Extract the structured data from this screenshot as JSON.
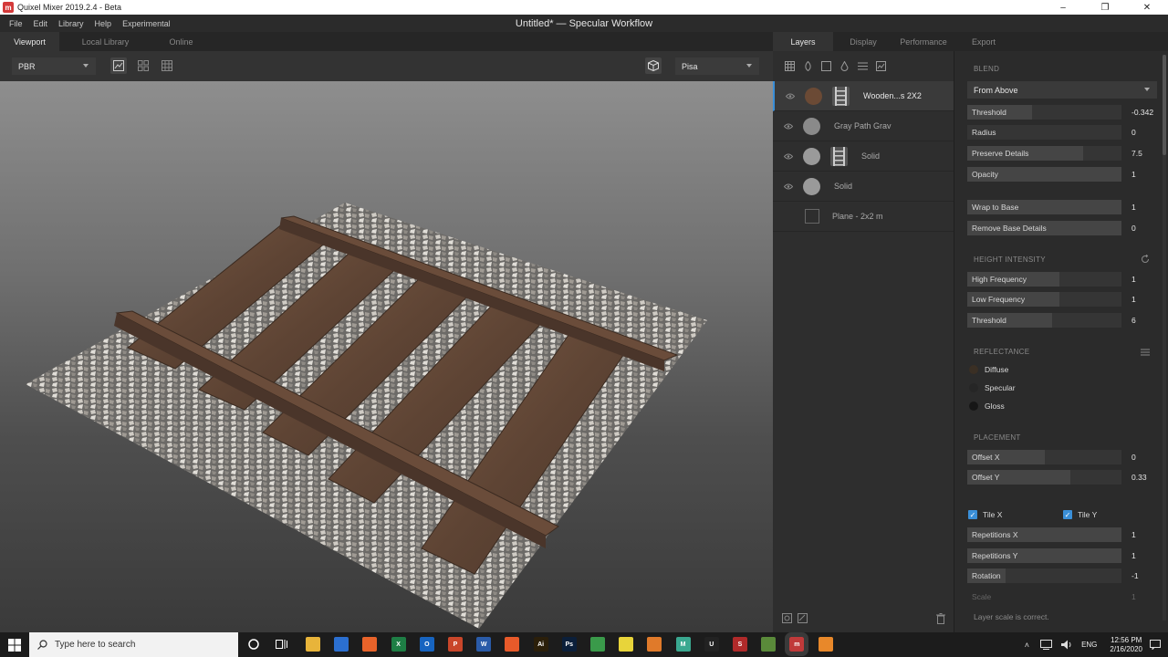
{
  "window": {
    "app_title": "Quixel Mixer 2019.2.4 - Beta",
    "doc_title": "Untitled* — Specular Workflow",
    "minimize": "–",
    "maximize": "❐",
    "close": "✕",
    "app_icon_glyph": "m"
  },
  "menu": [
    "File",
    "Edit",
    "Library",
    "Help",
    "Experimental"
  ],
  "viewport_tabs": [
    "Viewport",
    "Local Library",
    "Online"
  ],
  "viewport_toolbar": {
    "render_mode": "PBR",
    "environment": "Pisa"
  },
  "panel_tabs": [
    "Layers",
    "Display",
    "Performance",
    "Export"
  ],
  "layers": [
    {
      "name": "Wooden...s 2X2",
      "thumb_color": "#6b4a35",
      "has_mask": true,
      "selected": true
    },
    {
      "name": "Gray Path Grav",
      "thumb_color": "#8a8a8a",
      "has_mask": false,
      "selected": false
    },
    {
      "name": "Solid",
      "thumb_color": "#9a9a9a",
      "has_mask": true,
      "selected": false
    },
    {
      "name": "Solid",
      "thumb_color": "#9a9a9a",
      "has_mask": false,
      "selected": false
    },
    {
      "name": "Plane - 2x2 m",
      "thumb_color": "",
      "has_mask": false,
      "selected": false
    }
  ],
  "blend": {
    "title": "BLEND",
    "mode": "From Above",
    "rows": [
      {
        "label": "Threshold",
        "value": "-0.342",
        "fill": 0.42
      },
      {
        "label": "Radius",
        "value": "0",
        "fill": 0.0
      },
      {
        "label": "Preserve Details",
        "value": "7.5",
        "fill": 0.75
      },
      {
        "label": "Opacity",
        "value": "1",
        "fill": 1.0
      },
      {
        "label": "Wrap to Base",
        "value": "1",
        "fill": 1.0
      },
      {
        "label": "Remove Base Details",
        "value": "0",
        "fill": 1.0
      }
    ]
  },
  "height_intensity": {
    "title": "HEIGHT INTENSITY",
    "rows": [
      {
        "label": "High Frequency",
        "value": "1",
        "fill": 0.6
      },
      {
        "label": "Low Frequency",
        "value": "1",
        "fill": 0.6
      },
      {
        "label": "Threshold",
        "value": "6",
        "fill": 0.55
      }
    ]
  },
  "reflectance": {
    "title": "REFLECTANCE",
    "items": [
      {
        "label": "Diffuse",
        "color": "#3a2f24"
      },
      {
        "label": "Specular",
        "color": "#262626"
      },
      {
        "label": "Gloss",
        "color": "#161616"
      }
    ]
  },
  "placement": {
    "title": "PLACEMENT",
    "rows": [
      {
        "label": "Offset X",
        "value": "0",
        "fill": 0.5
      },
      {
        "label": "Offset Y",
        "value": "0.33",
        "fill": 0.67
      }
    ],
    "tile_x": "Tile X",
    "tile_y": "Tile Y",
    "rows2": [
      {
        "label": "Repetitions X",
        "value": "1",
        "fill": 1.0
      },
      {
        "label": "Repetitions Y",
        "value": "1",
        "fill": 1.0
      },
      {
        "label": "Rotation",
        "value": "-1",
        "fill": 0.25
      },
      {
        "label": "Scale",
        "value": "1",
        "fill": 0.0
      }
    ],
    "note": "Layer scale is correct."
  },
  "taskbar": {
    "search_placeholder": "Type here to search",
    "apps": [
      {
        "name": "explorer",
        "color": "#e8b43a",
        "glyph": ""
      },
      {
        "name": "store",
        "color": "#2b6fd0",
        "glyph": ""
      },
      {
        "name": "firefox",
        "color": "#e8632a",
        "glyph": ""
      },
      {
        "name": "excel",
        "color": "#1e7e45",
        "glyph": "X"
      },
      {
        "name": "outlook",
        "color": "#1764c0",
        "glyph": "O"
      },
      {
        "name": "powerpoint",
        "color": "#c9462a",
        "glyph": "P"
      },
      {
        "name": "word",
        "color": "#2a5ba8",
        "glyph": "W"
      },
      {
        "name": "brave",
        "color": "#e85a2a",
        "glyph": ""
      },
      {
        "name": "illustrator",
        "color": "#2b1f0a",
        "glyph": "Ai"
      },
      {
        "name": "photoshop",
        "color": "#0b1f3a",
        "glyph": "Ps"
      },
      {
        "name": "chrome",
        "color": "#3a9a4a",
        "glyph": ""
      },
      {
        "name": "sticky-notes",
        "color": "#e8d43a",
        "glyph": ""
      },
      {
        "name": "blender",
        "color": "#e07a2a",
        "glyph": ""
      },
      {
        "name": "mixer-app",
        "color": "#3aa890",
        "glyph": "M"
      },
      {
        "name": "unreal",
        "color": "#222222",
        "glyph": "U"
      },
      {
        "name": "substance",
        "color": "#b02a2a",
        "glyph": "S"
      },
      {
        "name": "minecraft",
        "color": "#5a8a3a",
        "glyph": ""
      },
      {
        "name": "quixel-mixer",
        "color": "#c03a3a",
        "glyph": "m"
      },
      {
        "name": "vlc",
        "color": "#e8882a",
        "glyph": ""
      }
    ],
    "lang": "ENG",
    "time": "12:56 PM",
    "date": "2/16/2020"
  }
}
